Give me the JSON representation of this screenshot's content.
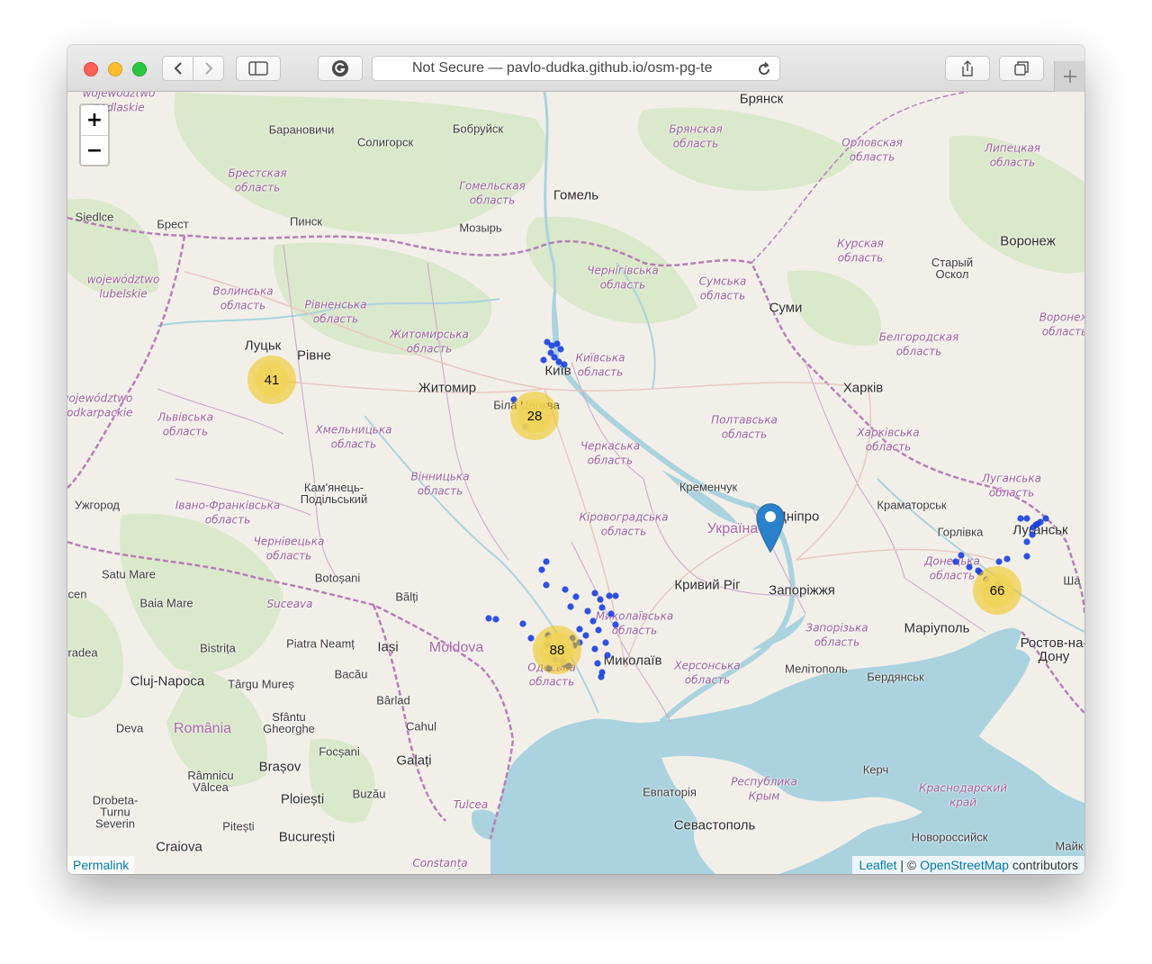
{
  "browser": {
    "address_text": "Not Secure — pavlo-dudka.github.io/osm-pg-te"
  },
  "map": {
    "zoom_in_label": "+",
    "zoom_out_label": "−",
    "permalink_label": "Permalink",
    "attribution": {
      "leaflet": "Leaflet",
      "separator": " | © ",
      "osm": "OpenStreetMap",
      "contributors": " contributors"
    },
    "colors": {
      "land": "#f2efe9",
      "water": "#aad3df",
      "forest": "#d8e8c8",
      "border": "#b77fb8",
      "cluster": "#f1d357",
      "point": "#1a3fe0",
      "marker": "#2a81cb"
    },
    "clusters": [
      {
        "count": "41"
      },
      {
        "count": "28"
      },
      {
        "count": "88"
      },
      {
        "count": "66"
      }
    ],
    "places": {
      "briansk": "Брянск",
      "baranovichi": "Барановичи",
      "soligorsk": "Солигорск",
      "bobruisk": "Бобруйск",
      "gomel": "Гомель",
      "mozyr": "Мозырь",
      "pinsk": "Пинск",
      "brest": "Брест",
      "siedlce": "Siedlce",
      "voronezh": "Воронеж",
      "stary_oskol": "Старый\nОскол",
      "sumy": "Суми",
      "kharkiv": "Харків",
      "rivne": "Рівне",
      "lutsk": "Луцьк",
      "zhytomyr": "Житомир",
      "kyiv": "Київ",
      "bila_tserkva": "Біла Церква",
      "kamianets": "Кам'янець-\nПодільський",
      "uzhhorod": "Ужгород",
      "kremenchuk": "Кременчук",
      "dnipro": "Дніпро",
      "ukraina": "Україна",
      "kramatorsk": "Краматорськ",
      "horlivka": "Горлівка",
      "luhansk": "Луганськ",
      "kryvyi_rih": "Кривий Ріг",
      "zaporizhzhia": "Запоріжжя",
      "mariupol": "Маріуполь",
      "rostov": "Ростов-на-\nДону",
      "mykolaiv": "Миколаїв",
      "odesa_label": "Одеська\nобласть",
      "melitopol": "Мелітополь",
      "berdiansk": "Бердянськ",
      "kerch": "Керч",
      "yevpatoria": "Евпаторія",
      "sevastopol": "Севастополь",
      "novorossiysk": "Новороссийск",
      "satu_mare": "Satu Mare",
      "baia_mare": "Baia Mare",
      "suceava": "Suceava",
      "botosani": "Botoșani",
      "balti": "Bălți",
      "moldova": "Moldova",
      "bistrita": "Bistrița",
      "piatra": "Piatra Neamț",
      "iasi": "Iași",
      "cluj": "Cluj-Napoca",
      "targu": "Târgu Mureș",
      "bacau": "Bacău",
      "barlad": "Bârlad",
      "romania": "România",
      "sfantu": "Sfântu\nGheorghe",
      "cahul": "Cahul",
      "deva": "Deva",
      "focsani": "Focșani",
      "galati": "Galați",
      "brasov": "Brașov",
      "ramnicu": "Râmnicu\nVâlcea",
      "ploiesti": "Ploiești",
      "buzau": "Buzău",
      "tulcea": "Tulcea",
      "drobeta": "Drobeta-\nTurnu\nSeverin",
      "pitesti": "Pitești",
      "bucuresti": "București",
      "craiova": "Craiova",
      "constanta": "Constanța",
      "oradea": "radea",
      "cen": "cen",
      "sha": "Ша",
      "maik": "Майк",
      "voronezh_reg": "Воронеж\nобласть"
    },
    "regions": {
      "podlaskie": "województwo\npodlaskie",
      "brestskaya": "Брестская\nобласть",
      "gomelskaya": "Гомельская\nобласть",
      "bryanskaya": "Брянская\nобласть",
      "orlovskaya": "Орловская\nобласть",
      "lipetskaya": "Липецкая\nобласть",
      "kurskaya": "Курская\nобласть",
      "belgorodskaya": "Белгородская\nобласть",
      "lubelskie": "województwo\nlubelskie",
      "volynska": "Волинська\nобласть",
      "rivnenska": "Рівненська\nобласть",
      "zhytomyrska": "Житомирська\nобласть",
      "chernihivska": "Чернігівська\nобласть",
      "sumska": "Сумська\nобласть",
      "kyivska": "Київська\nобласть",
      "podkarpackie": "województwo\npodkarpackie",
      "lvivska": "Львівська\nобласть",
      "khmelnytska": "Хмельницька\nобласть",
      "poltavska": "Полтавська\nобласть",
      "kharkivska": "Харківська\nобласть",
      "cherkaska": "Черкаська\nобласть",
      "vinnytska": "Вінницька\nобласть",
      "ivano": "Івано-Франківська\nобласть",
      "chernivetska": "Чернівецька\nобласть",
      "kirovohradska": "Кіровоградська\nобласть",
      "luhanska": "Луганська\nобласть",
      "donetska": "Донецька\nобласть",
      "mykolaivska": "Миколаївська\nобласть",
      "zaporizka": "Запорізька\nобласть",
      "khersonska": "Херсонська\nобласть",
      "krym": "Республика\nКрым",
      "krasnodar": "Краснодарский\nкрай"
    }
  }
}
